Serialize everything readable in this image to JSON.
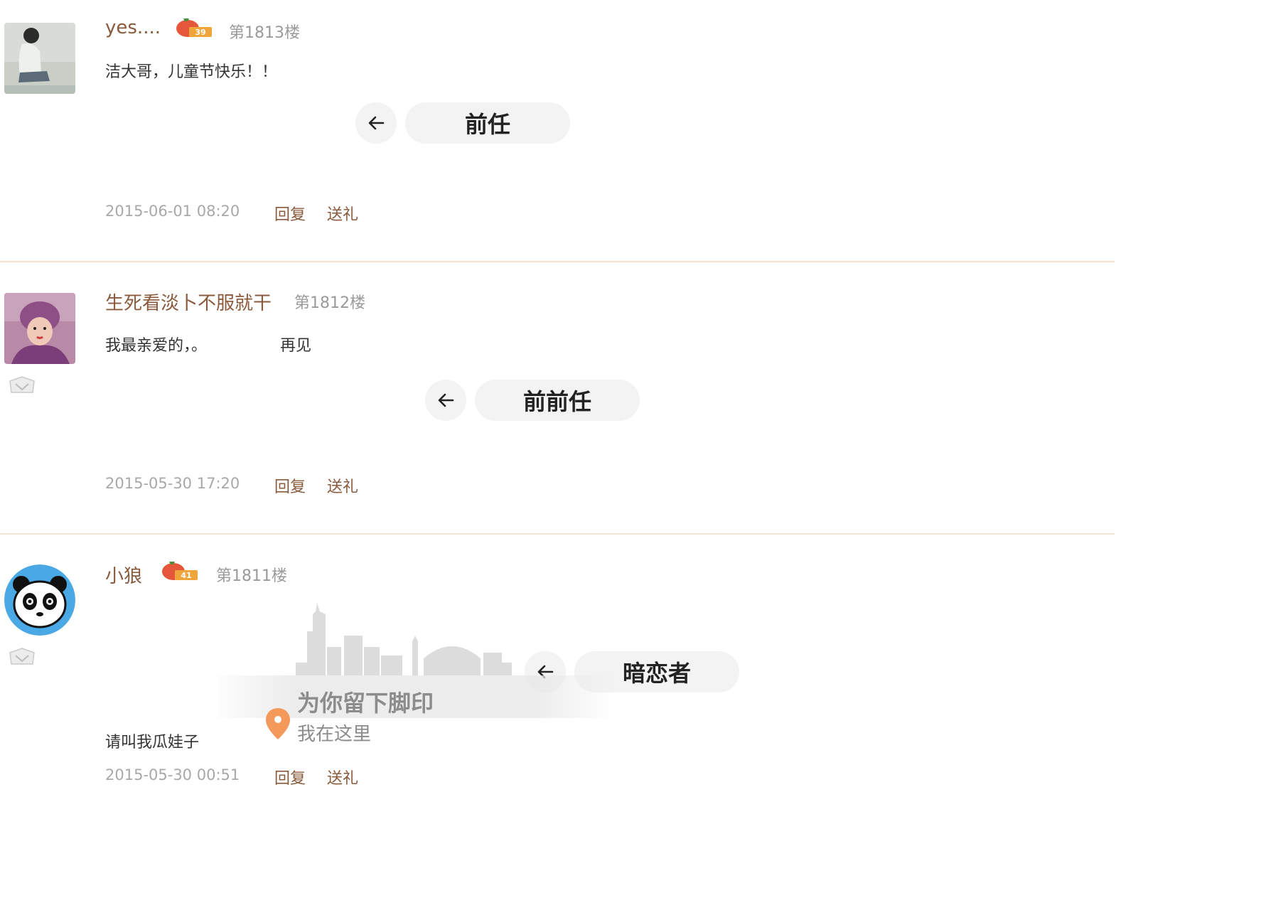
{
  "posts": [
    {
      "username": "yes....",
      "floor": "第1813楼",
      "content": "洁大哥，儿童节快乐！！",
      "content_extra": "",
      "pill_label": "前任",
      "time": "2015-06-01 08:20",
      "reply_label": "回复",
      "gift_label": "送礼",
      "level": "39"
    },
    {
      "username": "生死看淡卜不服就干",
      "floor": "第1812楼",
      "content": "我最亲爱的，。",
      "content_extra": "再见",
      "pill_label": "前前任",
      "time": "2015-05-30 17:20",
      "reply_label": "回复",
      "gift_label": "送礼"
    },
    {
      "username": "小狼",
      "floor": "第1811楼",
      "content": "请叫我瓜娃子",
      "pill_label": "暗恋者",
      "time": "2015-05-30 00:51",
      "reply_label": "回复",
      "gift_label": "送礼",
      "level": "41"
    }
  ],
  "location": {
    "title": "为你留下脚印",
    "subtitle": "我在这里"
  },
  "icons": {
    "back": "arrow-left-icon",
    "pin": "location-pin-icon",
    "vip": "vip-badge-icon",
    "level": "level-badge-icon"
  },
  "colors": {
    "username": "#8a5a3c",
    "divider": "#efe3d1",
    "pin": "#f39a5b",
    "pill_bg": "#f3f3f3"
  }
}
